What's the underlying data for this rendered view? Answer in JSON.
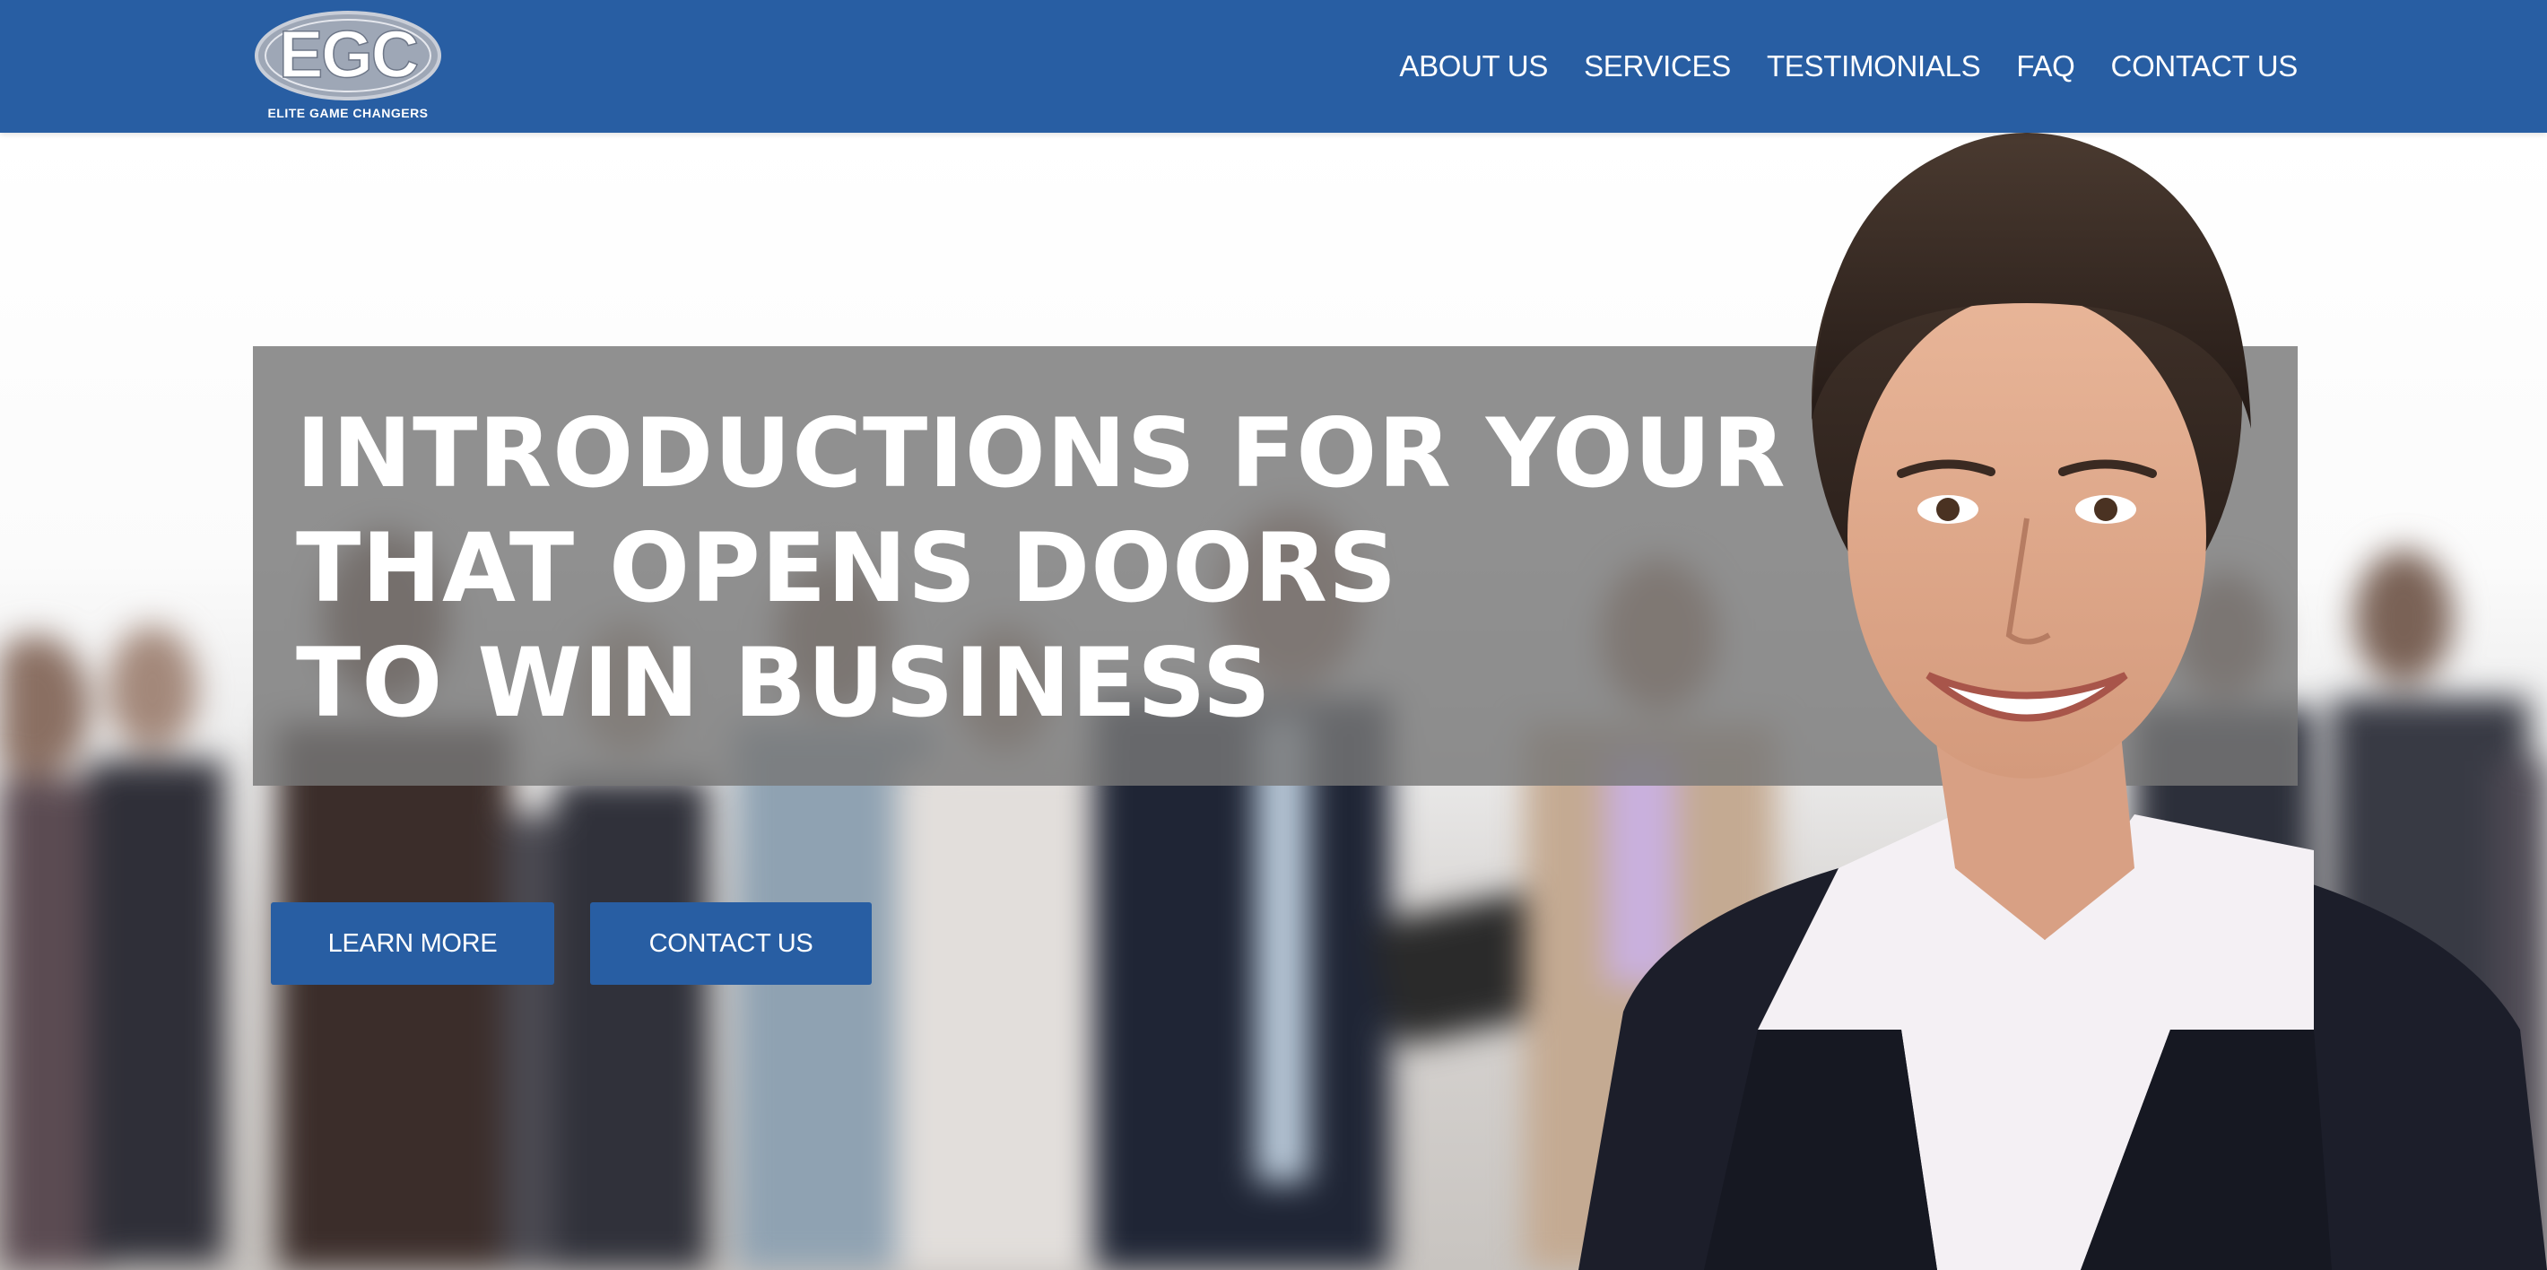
{
  "header": {
    "logo_text": "EGC",
    "logo_tagline": "ELITE GAME CHANGERS",
    "nav": [
      {
        "label": "ABOUT US"
      },
      {
        "label": "SERVICES"
      },
      {
        "label": "TESTIMONIALS"
      },
      {
        "label": "FAQ"
      },
      {
        "label": "CONTACT US"
      }
    ]
  },
  "hero": {
    "headline_lines": [
      "INTRODUCTIONS FOR YOUR BRAND",
      "THAT OPENS DOORS",
      "TO WIN BUSINESS"
    ],
    "buttons": {
      "learn_more": "LEARN MORE",
      "contact_us": "CONTACT US"
    }
  },
  "colors": {
    "brand_blue": "#285ea3",
    "band_gray": "#7a7a7a",
    "text_white": "#ffffff"
  }
}
